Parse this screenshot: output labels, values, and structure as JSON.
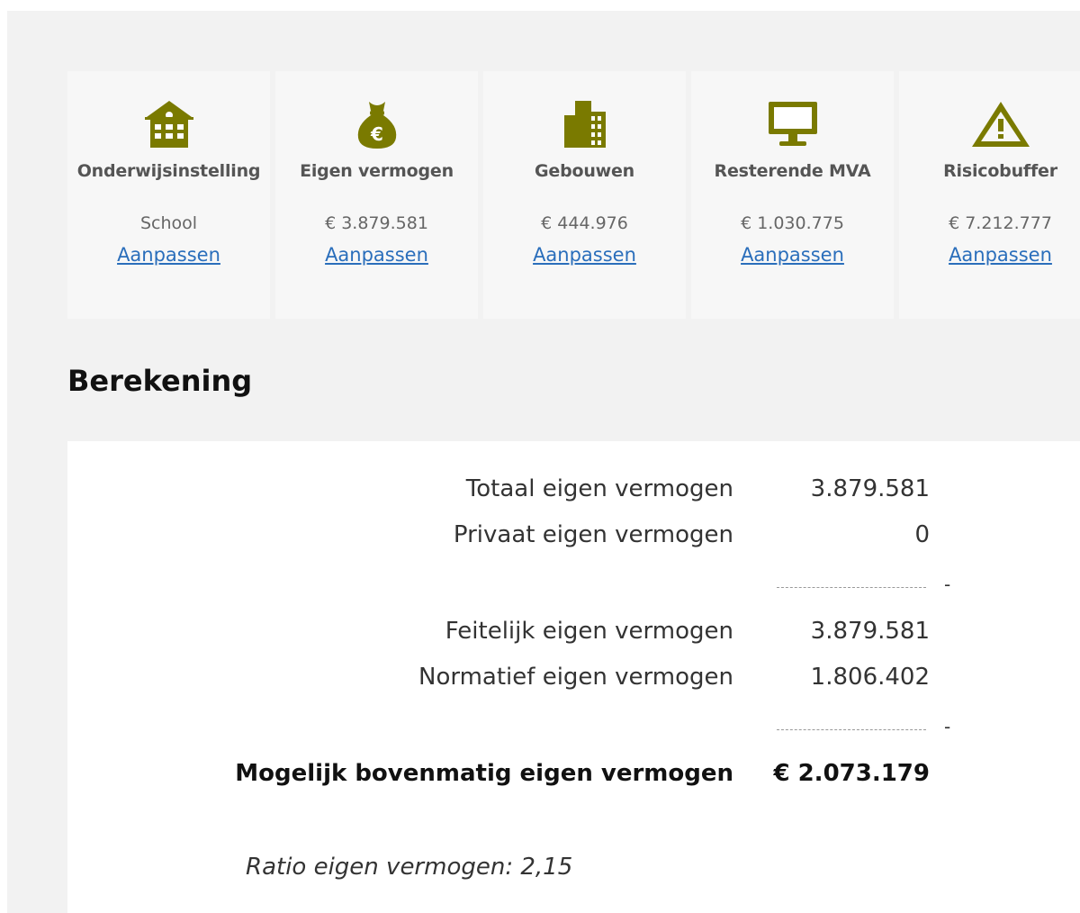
{
  "cards": [
    {
      "icon": "school-building-icon",
      "title": "Onderwijsinstelling",
      "value": "School",
      "link": "Aanpassen"
    },
    {
      "icon": "money-bag-euro-icon",
      "title": "Eigen vermogen",
      "value": "€ 3.879.581",
      "link": "Aanpassen"
    },
    {
      "icon": "office-building-icon",
      "title": "Gebouwen",
      "value": "€ 444.976",
      "link": "Aanpassen"
    },
    {
      "icon": "computer-monitor-icon",
      "title": "Resterende MVA",
      "value": "€ 1.030.775",
      "link": "Aanpassen"
    },
    {
      "icon": "warning-triangle-icon",
      "title": "Risicobuffer",
      "value": "€ 7.212.777",
      "link": "Aanpassen"
    }
  ],
  "section_title": "Berekening",
  "calculation": {
    "rows": [
      {
        "label": "Totaal eigen vermogen",
        "value": "3.879.581"
      },
      {
        "label": "Privaat eigen vermogen",
        "value": "0"
      },
      {
        "label": "Feitelijk eigen vermogen",
        "value": "3.879.581"
      },
      {
        "label": "Normatief eigen vermogen",
        "value": "1.806.402"
      }
    ],
    "separator_minus": "-",
    "total": {
      "label": "Mogelijk bovenmatig eigen vermogen",
      "value": "€ 2.073.179"
    },
    "ratio_label": "Ratio eigen vermogen:",
    "ratio_value": "2,15"
  },
  "colors": {
    "icon": "#7a7a00",
    "link": "#2a6ebb",
    "background": "#f2f2f2",
    "card": "#f7f7f7"
  }
}
